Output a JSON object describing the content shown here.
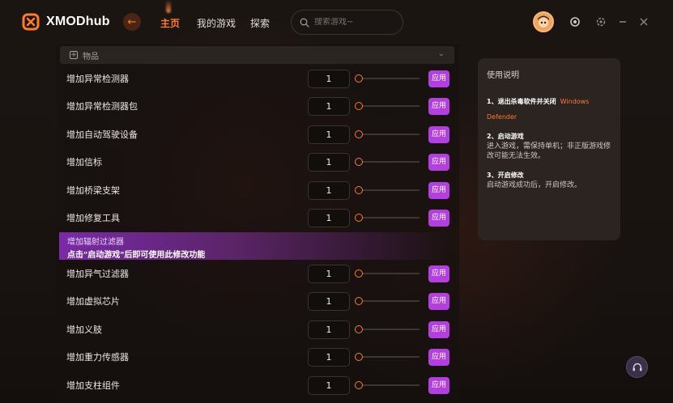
{
  "app": {
    "brand": "XMODhub"
  },
  "nav": {
    "back_icon": "back-arrow-icon",
    "items": [
      {
        "label": "主页",
        "active": true
      },
      {
        "label": "我的游戏",
        "active": false
      },
      {
        "label": "探索",
        "active": false
      }
    ]
  },
  "search": {
    "placeholder": "搜索游戏~"
  },
  "colors": {
    "accent": "#ff7a2a",
    "apply_button": "#b43fe0"
  },
  "category": {
    "label": "物品"
  },
  "rows": [
    {
      "label": "增加异常检测器",
      "value": "1",
      "apply": "应用"
    },
    {
      "label": "增加异常检测器包",
      "value": "1",
      "apply": "应用"
    },
    {
      "label": "增加自动驾驶设备",
      "value": "1",
      "apply": "应用"
    },
    {
      "label": "增加信标",
      "value": "1",
      "apply": "应用"
    },
    {
      "label": "增加桥梁支架",
      "value": "1",
      "apply": "应用"
    },
    {
      "label": "增加修复工具",
      "value": "1",
      "apply": "应用"
    },
    {
      "label": "增加异气过滤器",
      "value": "1",
      "apply": "应用"
    },
    {
      "label": "增加虚拟芯片",
      "value": "1",
      "apply": "应用"
    },
    {
      "label": "增加义肢",
      "value": "1",
      "apply": "应用"
    },
    {
      "label": "增加重力传感器",
      "value": "1",
      "apply": "应用"
    },
    {
      "label": "增加支柱组件",
      "value": "1",
      "apply": "应用"
    }
  ],
  "banner": {
    "label": "增加辐射过滤器",
    "message": "点击\"启动游戏\"后即可使用此修改功能"
  },
  "info": {
    "title": "使用说明",
    "step1_head": "1、退出杀毒软件并关闭",
    "step1_highlight": "Windows Defender",
    "step2_head": "2、启动游戏",
    "step2_body": "进入游戏，需保持单机；非正版游戏修改可能无法生效。",
    "step3_head": "3、开启修改",
    "step3_body": "启动游戏成功后，开启修改。"
  }
}
